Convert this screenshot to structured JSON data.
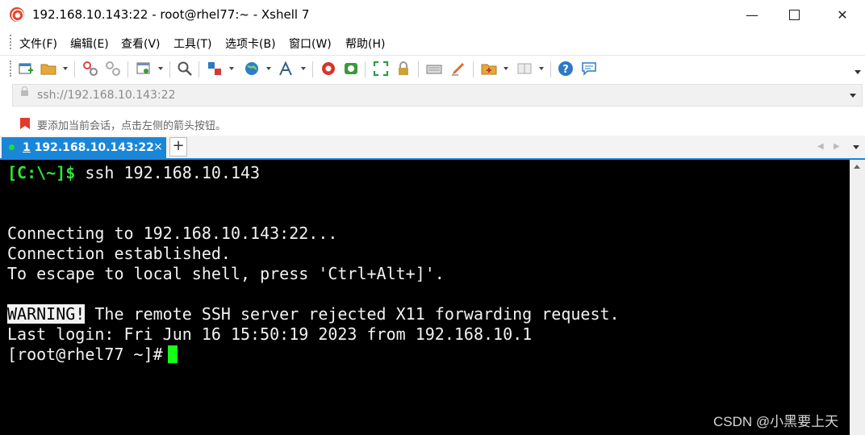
{
  "window": {
    "title": "192.168.10.143:22 - root@rhel77:~ - Xshell 7"
  },
  "menu": [
    "文件(F)",
    "编辑(E)",
    "查看(V)",
    "工具(T)",
    "选项卡(B)",
    "窗口(W)",
    "帮助(H)"
  ],
  "address": {
    "value": "ssh://192.168.10.143:22"
  },
  "hint": {
    "text": "要添加当前会话，点击左侧的箭头按钮。"
  },
  "tab": {
    "number": "1",
    "label": " 192.168.10.143:22",
    "close": "×",
    "add": "+"
  },
  "terminal": {
    "lines": [
      {
        "prompt": "[C:\\~]$",
        "text": " ssh 192.168.10.143"
      },
      {
        "text": "Connecting to 192.168.10.143:22..."
      },
      {
        "text": "Connection established."
      },
      {
        "text": "To escape to local shell, press 'Ctrl+Alt+]'."
      },
      {
        "badge": "WARNING!",
        "text": " The remote SSH server rejected X11 forwarding request."
      },
      {
        "text": "Last login: Fri Jun 16 15:50:19 2023 from 192.168.10.1"
      },
      {
        "text": "[root@rhel77 ~]#"
      }
    ]
  },
  "watermark": "CSDN @小黑要上天",
  "colors": {
    "accent": "#1a86d8",
    "prompt": "#2ee53b",
    "cursor": "#16ff16",
    "terminal_bg": "#000000"
  }
}
